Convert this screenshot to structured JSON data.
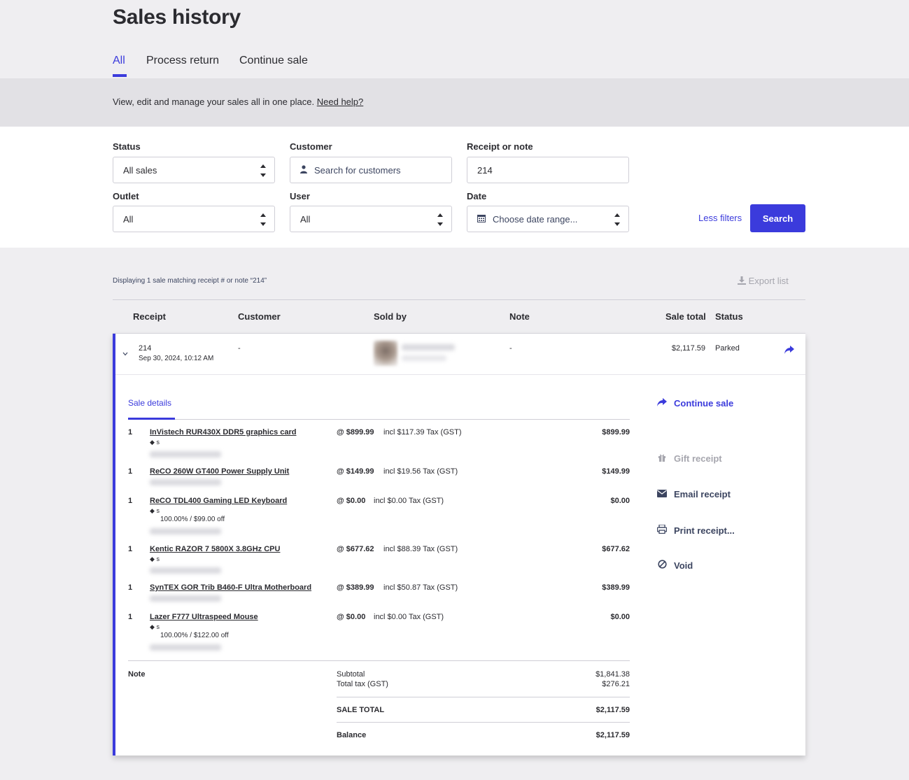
{
  "page": {
    "title": "Sales history"
  },
  "tabs": [
    {
      "label": "All",
      "active": true
    },
    {
      "label": "Process return",
      "active": false
    },
    {
      "label": "Continue sale",
      "active": false
    }
  ],
  "info": {
    "text": "View, edit and manage your sales all in one place.",
    "help_link": "Need help?"
  },
  "filters": {
    "status": {
      "label": "Status",
      "value": "All sales"
    },
    "customer": {
      "label": "Customer",
      "placeholder": "Search for customers"
    },
    "receipt": {
      "label": "Receipt or note",
      "value": "214"
    },
    "outlet": {
      "label": "Outlet",
      "value": "All"
    },
    "user": {
      "label": "User",
      "value": "All"
    },
    "date": {
      "label": "Date",
      "placeholder": "Choose date range..."
    },
    "less_filters": "Less filters",
    "search": "Search"
  },
  "results": {
    "display_text": "Displaying 1 sale matching receipt # or note “214”",
    "export": "Export list"
  },
  "table": {
    "headers": {
      "receipt": "Receipt",
      "customer": "Customer",
      "sold_by": "Sold by",
      "note": "Note",
      "sale_total": "Sale total",
      "status": "Status"
    },
    "row": {
      "receipt": "214",
      "date": "Sep 30, 2024, 10:12 AM",
      "customer": "-",
      "note": "-",
      "total": "$2,117.59",
      "status": "Parked"
    }
  },
  "details": {
    "tab": "Sale details",
    "items": [
      {
        "qty": "1",
        "name": "InVistech RUR430X DDR5 graphics card",
        "tag": "s",
        "discount": "",
        "price": "@ $899.99",
        "tax": "incl $117.39 Tax (GST)",
        "total": "$899.99"
      },
      {
        "qty": "1",
        "name": "ReCO 260W GT400 Power Supply Unit",
        "tag": "",
        "discount": "",
        "price": "@ $149.99",
        "tax": "incl $19.56 Tax (GST)",
        "total": "$149.99"
      },
      {
        "qty": "1",
        "name": "ReCO TDL400 Gaming LED Keyboard",
        "tag": "s",
        "discount": "100.00% / $99.00 off",
        "price": "@ $0.00",
        "tax": "incl $0.00 Tax (GST)",
        "total": "$0.00"
      },
      {
        "qty": "1",
        "name": "Kentic RAZOR 7 5800X 3.8GHz CPU",
        "tag": "s",
        "discount": "",
        "price": "@ $677.62",
        "tax": "incl $88.39 Tax (GST)",
        "total": "$677.62"
      },
      {
        "qty": "1",
        "name": "SynTEX GOR Trib B460-F Ultra Motherboard",
        "tag": "",
        "discount": "",
        "price": "@ $389.99",
        "tax": "incl $50.87 Tax (GST)",
        "total": "$389.99"
      },
      {
        "qty": "1",
        "name": "Lazer F777 Ultraspeed Mouse",
        "tag": "s",
        "discount": "100.00% / $122.00 off",
        "price": "@ $0.00",
        "tax": "incl $0.00 Tax (GST)",
        "total": "$0.00"
      }
    ],
    "note_label": "Note",
    "subtotal_label": "Subtotal",
    "subtotal": "$1,841.38",
    "tax_label": "Total tax (GST)",
    "tax": "$276.21",
    "sale_total_label": "SALE TOTAL",
    "sale_total": "$2,117.59",
    "balance_label": "Balance",
    "balance": "$2,117.59"
  },
  "actions": {
    "continue_sale": "Continue sale",
    "gift_receipt": "Gift receipt",
    "email_receipt": "Email receipt",
    "print_receipt": "Print receipt...",
    "void": "Void"
  },
  "colors": {
    "accent": "#3b3bdc",
    "disabled": "#a6a6ae",
    "text": "#2b2b30",
    "secondary": "#3c4560"
  }
}
